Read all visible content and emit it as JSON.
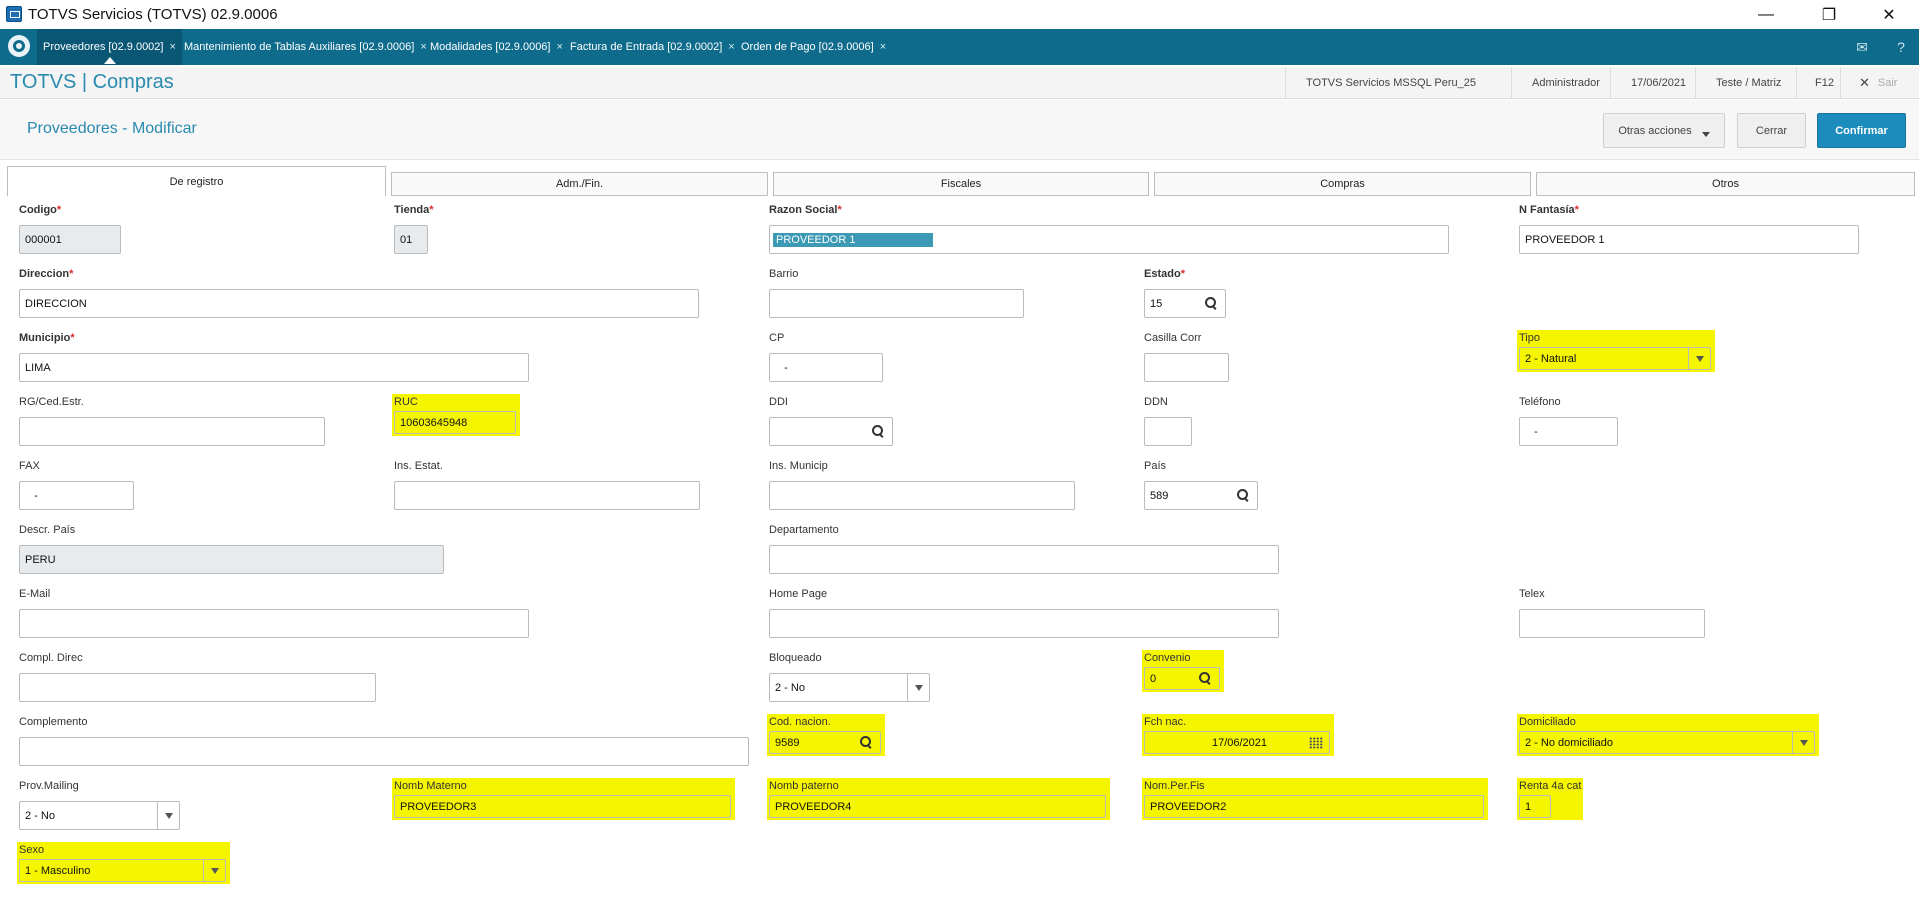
{
  "window": {
    "title": "TOTVS Servicios (TOTVS) 02.9.0006",
    "min": "—",
    "restore": "❐",
    "close": "✕"
  },
  "tabs": [
    {
      "label": "Proveedores [02.9.0002]"
    },
    {
      "label": "Mantenimiento de Tablas Auxiliares [02.9.0006]"
    },
    {
      "label": "Modalidades [02.9.0006]"
    },
    {
      "label": "Factura de Entrada [02.9.0002]"
    },
    {
      "label": "Orden de Pago [02.9.0006]"
    }
  ],
  "tab_close": "×",
  "header": {
    "brand": "TOTVS | Compras",
    "company": "TOTVS Servicios MSSQL Peru_25",
    "user": "Administrador",
    "date": "17/06/2021",
    "branch": "Teste / Matriz",
    "key": "F12",
    "exit": "Sair",
    "exit_icon": "✕"
  },
  "page": {
    "title": "Proveedores - Modificar",
    "other_actions": "Otras acciones",
    "close": "Cerrar",
    "confirm": "Confirmar"
  },
  "form_tabs": [
    "De registro",
    "Adm./Fin.",
    "Fiscales",
    "Compras",
    "Otros"
  ],
  "fields": {
    "codigo": {
      "label": "Codigo",
      "value": "000001"
    },
    "tienda": {
      "label": "Tienda",
      "value": "01"
    },
    "razon_social": {
      "label": "Razon Social",
      "value": "PROVEEDOR 1"
    },
    "n_fantasia": {
      "label": "N Fantasía",
      "value": "PROVEEDOR 1"
    },
    "direccion": {
      "label": "Direccion",
      "value": "DIRECCION"
    },
    "barrio": {
      "label": "Barrio",
      "value": ""
    },
    "estado": {
      "label": "Estado",
      "value": "15"
    },
    "municipio": {
      "label": "Municipio",
      "value": "LIMA"
    },
    "cp": {
      "label": "CP",
      "value": "   -"
    },
    "casilla_corr": {
      "label": "Casilla Corr",
      "value": ""
    },
    "tipo": {
      "label": "Tipo",
      "value": "2 - Natural"
    },
    "rg_ced": {
      "label": "RG/Ced.Estr.",
      "value": ""
    },
    "ruc": {
      "label": "RUC",
      "value": "10603645948"
    },
    "ddi": {
      "label": "DDI",
      "value": ""
    },
    "ddn": {
      "label": "DDN",
      "value": ""
    },
    "telefono": {
      "label": "Teléfono",
      "value": "   -"
    },
    "fax": {
      "label": "FAX",
      "value": "   -"
    },
    "ins_estat": {
      "label": "Ins. Estat.",
      "value": ""
    },
    "ins_municip": {
      "label": "Ins. Municip",
      "value": ""
    },
    "pais": {
      "label": "País",
      "value": "589"
    },
    "descr_pais": {
      "label": "Descr. País",
      "value": "PERU"
    },
    "departamento": {
      "label": "Departamento",
      "value": ""
    },
    "email": {
      "label": "E-Mail",
      "value": ""
    },
    "home_page": {
      "label": "Home Page",
      "value": ""
    },
    "telex": {
      "label": "Telex",
      "value": ""
    },
    "compl_direc": {
      "label": "Compl. Direc",
      "value": ""
    },
    "bloqueado": {
      "label": "Bloqueado",
      "value": "2 - No"
    },
    "convenio": {
      "label": "Convenio",
      "value": "0"
    },
    "complemento": {
      "label": "Complemento",
      "value": ""
    },
    "cod_nacion": {
      "label": "Cod. nacion.",
      "value": "9589"
    },
    "fch_nac": {
      "label": "Fch nac.",
      "value": "17/06/2021"
    },
    "domiciliado": {
      "label": "Domiciliado",
      "value": "2 - No domiciliado"
    },
    "prov_mailing": {
      "label": "Prov.Mailing",
      "value": "2 - No"
    },
    "nomb_materno": {
      "label": "Nomb Materno",
      "value": "PROVEEDOR3"
    },
    "nomb_paterno": {
      "label": "Nomb paterno",
      "value": "PROVEEDOR4"
    },
    "nom_per_fis": {
      "label": "Nom.Per.Fis",
      "value": "PROVEEDOR2"
    },
    "renta_4a_cat": {
      "label": "Renta 4a cat",
      "value": "1"
    },
    "sexo": {
      "label": "Sexo",
      "value": "1 - Masculino"
    }
  },
  "required_mark": "*",
  "colors": {
    "tabbar": "#0e6b8c",
    "accent": "#2a8ab0",
    "confirm": "#1b8cbc",
    "highlight": "#f6f500",
    "required": "#d62c2c"
  }
}
